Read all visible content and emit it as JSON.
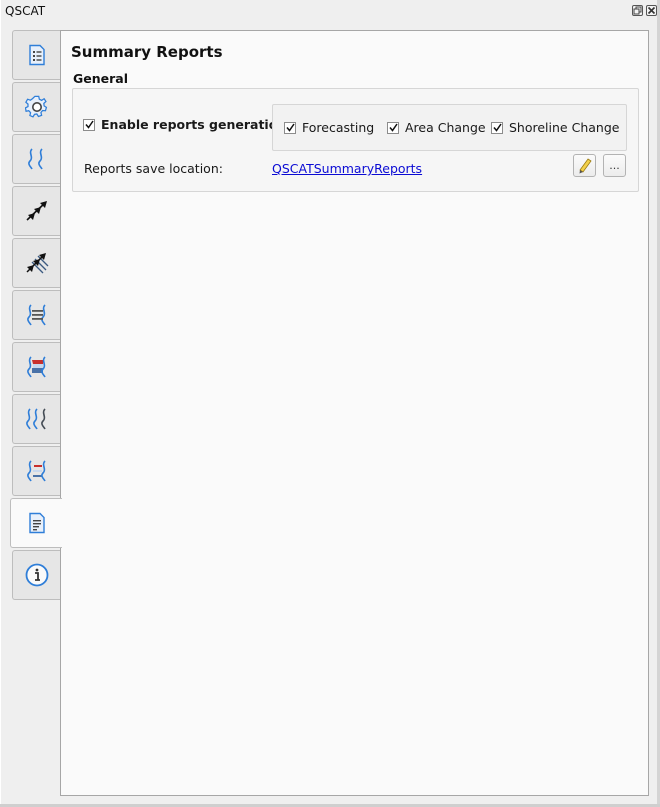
{
  "window": {
    "title": "QSCAT",
    "float_button_icon": "float-icon",
    "close_button_icon": "close-icon"
  },
  "tabs": [
    {
      "name": "project-settings",
      "icon": "list-document-icon",
      "active": false
    },
    {
      "name": "general-settings",
      "icon": "gear-icon",
      "active": false
    },
    {
      "name": "baseline",
      "icon": "shoreline-pair-icon",
      "active": false
    },
    {
      "name": "transects",
      "icon": "arrows-icon",
      "active": false
    },
    {
      "name": "transects-multi",
      "icon": "multi-arrows-icon",
      "active": false
    },
    {
      "name": "shoreline-change",
      "icon": "shoreline-change-icon",
      "active": false
    },
    {
      "name": "area-change",
      "icon": "area-change-icon",
      "active": false
    },
    {
      "name": "forecasting",
      "icon": "triple-shoreline-icon",
      "active": false
    },
    {
      "name": "visualization",
      "icon": "shoreline-colored-icon",
      "active": false
    },
    {
      "name": "summary-reports",
      "icon": "report-icon",
      "active": true
    },
    {
      "name": "about",
      "icon": "info-icon",
      "active": false
    }
  ],
  "main": {
    "title": "Summary Reports",
    "group_title": "General",
    "enable_reports": {
      "label": "Enable reports generation",
      "checked": true
    },
    "report_types": [
      {
        "label": "Forecasting",
        "checked": true
      },
      {
        "label": "Area Change",
        "checked": true
      },
      {
        "label": "Shoreline Change",
        "checked": true
      }
    ],
    "save_location_label": "Reports save location:",
    "save_location_value": "QSCATSummaryReports",
    "edit_button_icon": "pencil-icon",
    "browse_button_label": "..."
  },
  "colors": {
    "accent_blue": "#2f7ed8",
    "link": "#0b0bd4",
    "red": "#c9302c"
  }
}
